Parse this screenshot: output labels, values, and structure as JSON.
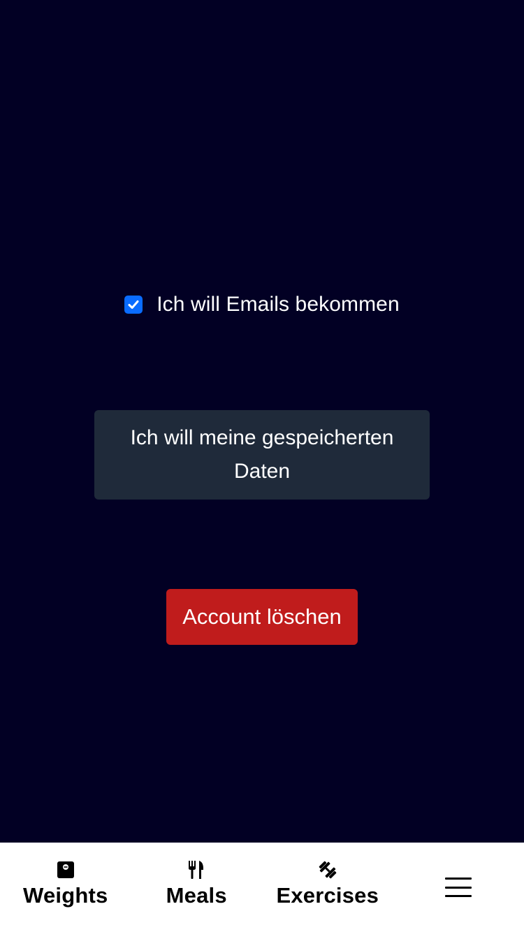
{
  "settings": {
    "email_label": "Ich will Emails bekommen",
    "email_checked": true,
    "data_button_label": "Ich will meine gespeicherten Daten",
    "delete_button_label": "Account löschen"
  },
  "nav": {
    "items": [
      {
        "label": "Weights",
        "icon": "scale-icon"
      },
      {
        "label": "Meals",
        "icon": "utensils-icon"
      },
      {
        "label": "Exercises",
        "icon": "dumbbell-icon"
      }
    ],
    "menu_icon": "hamburger-menu-icon"
  },
  "colors": {
    "background": "#020024",
    "checkbox": "#0a6cff",
    "data_button": "#1f2a3a",
    "delete_button": "#c01c1c",
    "nav_background": "#ffffff"
  }
}
